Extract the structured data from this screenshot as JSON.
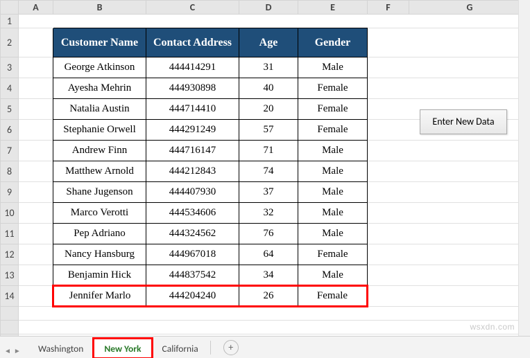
{
  "columns": [
    "A",
    "B",
    "C",
    "D",
    "E",
    "F",
    "G"
  ],
  "row_numbers": [
    1,
    2,
    3,
    4,
    5,
    6,
    7,
    8,
    9,
    10,
    11,
    12,
    13,
    14
  ],
  "table": {
    "headers": [
      "Customer Name",
      "Contact Address",
      "Age",
      "Gender"
    ],
    "rows": [
      {
        "name": "George Atkinson",
        "contact": "444414291",
        "age": "31",
        "gender": "Male"
      },
      {
        "name": "Ayesha Mehrin",
        "contact": "444930898",
        "age": "40",
        "gender": "Female"
      },
      {
        "name": "Natalia Austin",
        "contact": "444714410",
        "age": "20",
        "gender": "Female"
      },
      {
        "name": "Stephanie Orwell",
        "contact": "444291249",
        "age": "57",
        "gender": "Female"
      },
      {
        "name": "Andrew Finn",
        "contact": "444716147",
        "age": "71",
        "gender": "Male"
      },
      {
        "name": "Matthew Arnold",
        "contact": "444212843",
        "age": "74",
        "gender": "Male"
      },
      {
        "name": "Shane Jugenson",
        "contact": "444407930",
        "age": "37",
        "gender": "Male"
      },
      {
        "name": "Marco Verotti",
        "contact": "444534606",
        "age": "32",
        "gender": "Male"
      },
      {
        "name": "Pep Adriano",
        "contact": "444324562",
        "age": "76",
        "gender": "Male"
      },
      {
        "name": "Nancy Hansburg",
        "contact": "444967018",
        "age": "64",
        "gender": "Female"
      },
      {
        "name": "Benjamin Hick",
        "contact": "444837542",
        "age": "34",
        "gender": "Male"
      },
      {
        "name": "Jennifer Marlo",
        "contact": "444204240",
        "age": "26",
        "gender": "Female"
      }
    ]
  },
  "button_label": "Enter New Data",
  "tabs": [
    "Washington",
    "New York",
    "California"
  ],
  "active_tab": "New York",
  "watermark": "wsxdn.com"
}
